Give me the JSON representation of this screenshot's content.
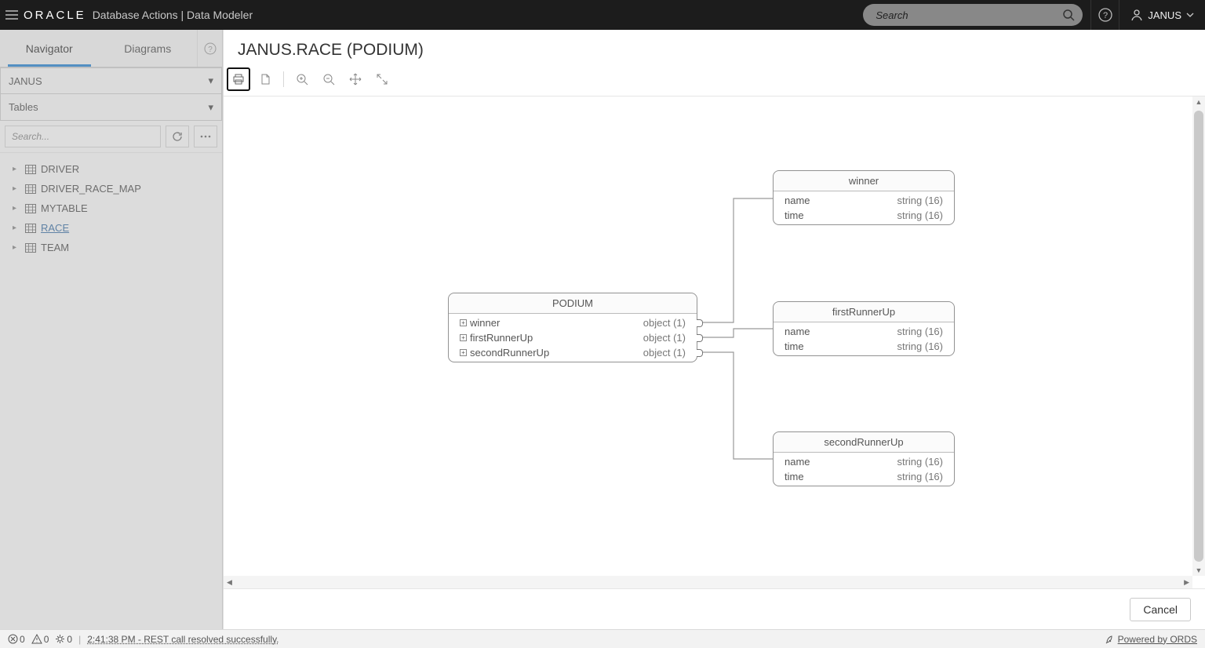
{
  "header": {
    "brand": "ORACLE",
    "app_title": "Database Actions | Data Modeler",
    "search_placeholder": "Search",
    "user": "JANUS"
  },
  "sidebar": {
    "tabs": {
      "navigator": "Navigator",
      "diagrams": "Diagrams"
    },
    "schema_select": "JANUS",
    "type_select": "Tables",
    "search_placeholder": "Search...",
    "tree_items": [
      {
        "name": "DRIVER"
      },
      {
        "name": "DRIVER_RACE_MAP"
      },
      {
        "name": "MYTABLE"
      },
      {
        "name": "RACE",
        "selected": true
      },
      {
        "name": "TEAM"
      }
    ]
  },
  "modal": {
    "title": "JANUS.RACE (PODIUM)",
    "cancel_label": "Cancel",
    "entities": {
      "podium": {
        "title": "PODIUM",
        "fields": [
          {
            "name": "winner",
            "type": "object (1)"
          },
          {
            "name": "firstRunnerUp",
            "type": "object (1)"
          },
          {
            "name": "secondRunnerUp",
            "type": "object (1)"
          }
        ]
      },
      "winner": {
        "title": "winner",
        "fields": [
          {
            "name": "name",
            "type": "string (16)"
          },
          {
            "name": "time",
            "type": "string (16)"
          }
        ]
      },
      "firstRunnerUp": {
        "title": "firstRunnerUp",
        "fields": [
          {
            "name": "name",
            "type": "string (16)"
          },
          {
            "name": "time",
            "type": "string (16)"
          }
        ]
      },
      "secondRunnerUp": {
        "title": "secondRunnerUp",
        "fields": [
          {
            "name": "name",
            "type": "string (16)"
          },
          {
            "name": "time",
            "type": "string (16)"
          }
        ]
      }
    }
  },
  "status": {
    "errors": "0",
    "warnings": "0",
    "processes": "0",
    "message": "2:41:38 PM - REST call resolved successfully.",
    "powered": "Powered by ORDS"
  }
}
